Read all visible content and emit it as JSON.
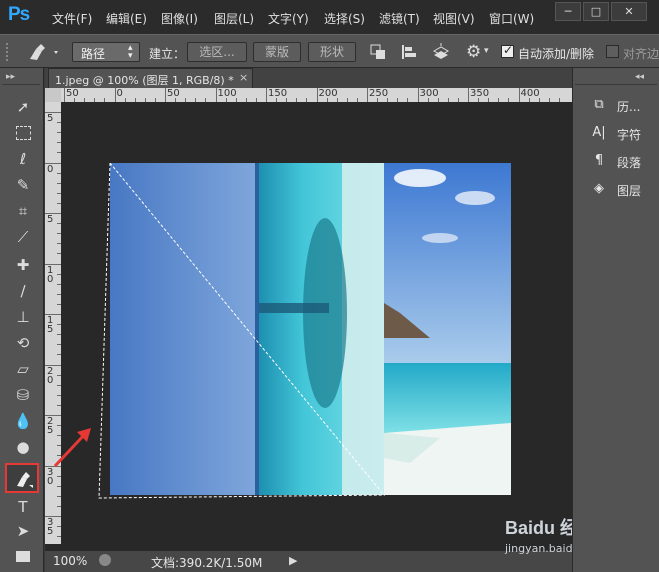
{
  "app": {
    "logo": "Ps"
  },
  "menu": [
    "文件(F)",
    "编辑(E)",
    "图像(I)",
    "图层(L)",
    "文字(Y)",
    "选择(S)",
    "滤镜(T)",
    "视图(V)",
    "窗口(W)"
  ],
  "window_controls": {
    "minimize": "─",
    "restore": "□",
    "close": "✕"
  },
  "options_bar": {
    "mode_value": "路径",
    "create_label": "建立：",
    "selection_button": "选区...",
    "mask_button": "蒙版",
    "shape_button": "形状",
    "auto_add_delete_label": "自动添加/删除",
    "auto_add_delete_checked": true,
    "align_edges_label": "对齐边缘",
    "align_edges_checked": false
  },
  "document": {
    "tab_title": "1.jpeg @ 100% (图层 1, RGB/8) *",
    "tab_close": "×"
  },
  "ruler": {
    "horizontal": [
      "50",
      "0",
      "50",
      "100",
      "150",
      "200",
      "250",
      "300",
      "350",
      "400"
    ],
    "vertical": [
      "5",
      "0",
      "5",
      "1 0",
      "1 5",
      "2 0",
      "2 5",
      "3 0",
      "3 5"
    ]
  },
  "right_panel": {
    "items": [
      {
        "icon": "history-icon",
        "label": "历..."
      },
      {
        "icon": "character-icon",
        "label": "字符"
      },
      {
        "icon": "paragraph-icon",
        "label": "段落"
      },
      {
        "icon": "layers-icon",
        "label": "图层"
      }
    ]
  },
  "status_bar": {
    "zoom": "100%",
    "doc_info": "文档:390.2K/1.50M"
  },
  "watermark": {
    "brand": "Baidu 经验",
    "url": "jingyan.baidu.com"
  },
  "colors": {
    "accent_blue": "#31a8ff",
    "highlight_red": "#e53935",
    "panel_gray": "#535353",
    "canvas_bg": "#282828"
  }
}
